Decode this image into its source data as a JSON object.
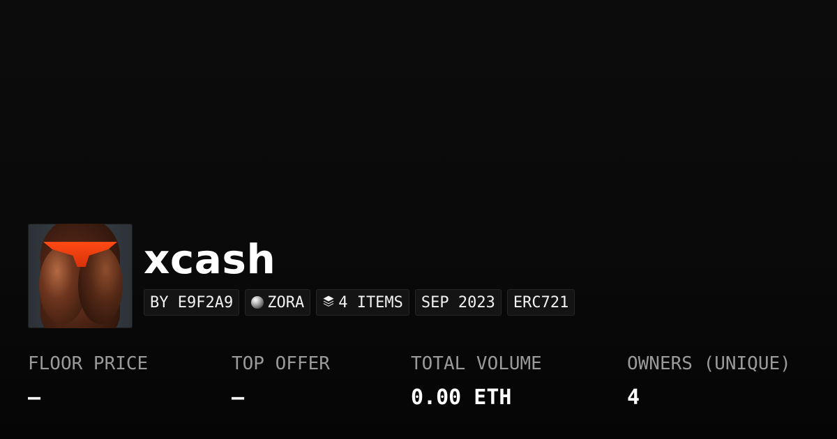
{
  "collection": {
    "name": "xcash",
    "avatar_icon": "collection-avatar-image"
  },
  "tags": {
    "creator": "BY E9F2A9",
    "chain": "ZORA",
    "chain_icon": "zora-orb-icon",
    "items": "4 ITEMS",
    "items_icon": "layers-icon",
    "date": "SEP 2023",
    "standard": "ERC721"
  },
  "stats": {
    "floor_price": {
      "label": "FLOOR PRICE",
      "value": "—"
    },
    "top_offer": {
      "label": "TOP OFFER",
      "value": "—"
    },
    "total_volume": {
      "label": "TOTAL VOLUME",
      "value": "0.00 ETH"
    },
    "owners": {
      "label": "OWNERS (UNIQUE)",
      "value": "4"
    }
  },
  "colors": {
    "background": "#0a0a0a",
    "tag_background": "#141414",
    "label": "#9a9a9a",
    "text": "#ffffff"
  }
}
